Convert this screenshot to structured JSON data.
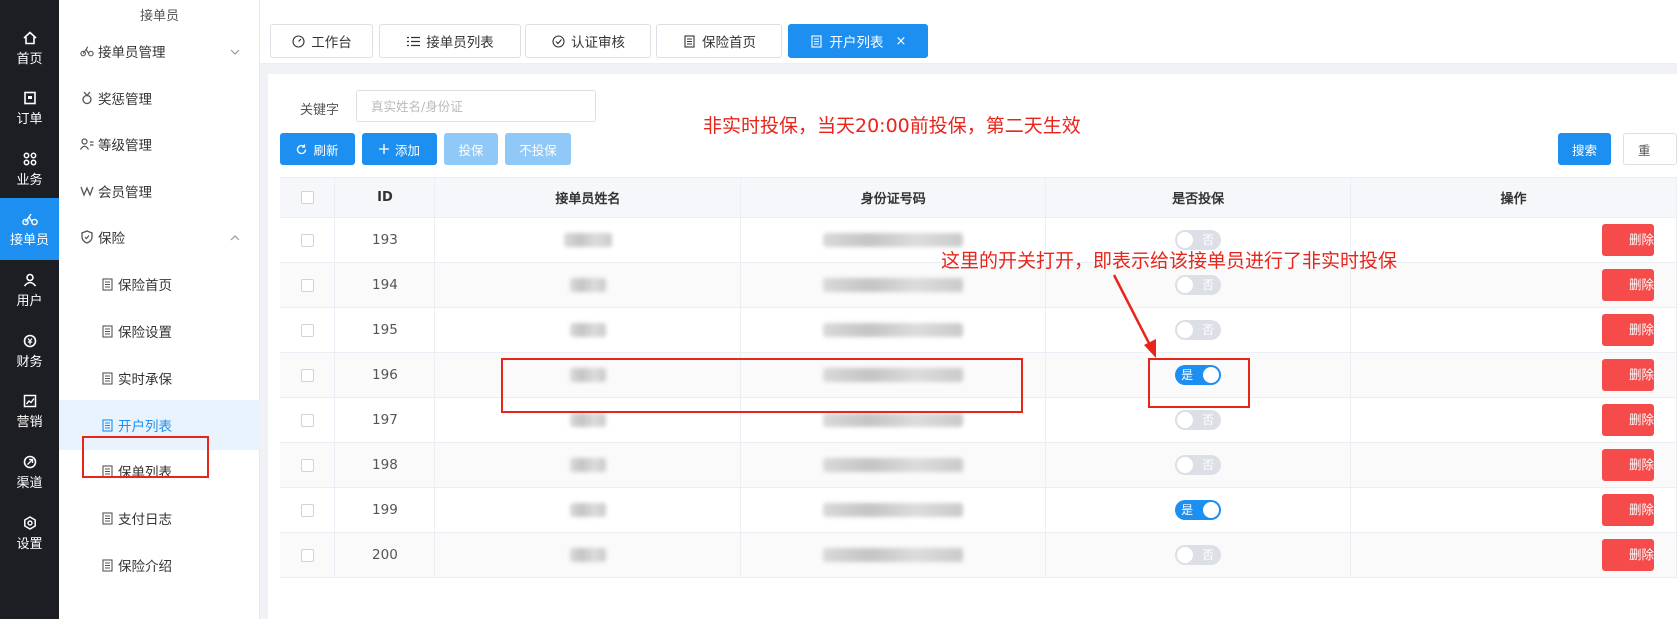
{
  "rail": [
    {
      "label": "首页",
      "icon": "home-icon"
    },
    {
      "label": "订单",
      "icon": "order-icon"
    },
    {
      "label": "业务",
      "icon": "business-icon"
    },
    {
      "label": "接单员",
      "icon": "rider-icon"
    },
    {
      "label": "用户",
      "icon": "user-icon"
    },
    {
      "label": "财务",
      "icon": "finance-icon"
    },
    {
      "label": "营销",
      "icon": "marketing-icon"
    },
    {
      "label": "渠道",
      "icon": "channel-icon"
    },
    {
      "label": "设置",
      "icon": "settings-icon"
    }
  ],
  "sidebar": {
    "title": "接单员",
    "items": [
      {
        "label": "接单员管理",
        "icon": "bike-icon"
      },
      {
        "label": "奖惩管理",
        "icon": "medal-icon"
      },
      {
        "label": "等级管理",
        "icon": "level-icon"
      },
      {
        "label": "会员管理",
        "icon": "vip-icon"
      },
      {
        "label": "保险",
        "icon": "shield-icon"
      },
      {
        "label": "保险首页",
        "icon": "doc-icon"
      },
      {
        "label": "保险设置",
        "icon": "doc-icon"
      },
      {
        "label": "实时承保",
        "icon": "doc-icon"
      },
      {
        "label": "开户列表",
        "icon": "doc-icon"
      },
      {
        "label": "保单列表",
        "icon": "doc-icon"
      },
      {
        "label": "支付日志",
        "icon": "doc-icon"
      },
      {
        "label": "保险介绍",
        "icon": "doc-icon"
      }
    ]
  },
  "tabs": [
    {
      "label": "工作台",
      "icon": "dashboard-icon"
    },
    {
      "label": "接单员列表",
      "icon": "list-icon"
    },
    {
      "label": "认证审核",
      "icon": "check-circle-icon"
    },
    {
      "label": "保险首页",
      "icon": "doc-icon"
    },
    {
      "label": "开户列表",
      "icon": "doc-icon",
      "close": "×"
    }
  ],
  "search": {
    "label": "关键字",
    "placeholder": "真实姓名/身份证"
  },
  "toolbar": {
    "refresh": "刷新",
    "add": "添加",
    "insure": "投保",
    "no_insure": "不投保",
    "search": "搜索",
    "reset": "重"
  },
  "annotations": {
    "notice": "非实时投保，当天20:00前投保，第二天生效",
    "switch_note": "这里的开关打开，即表示给该接单员进行了非实时投保"
  },
  "table": {
    "headers": [
      "ID",
      "接单员姓名",
      "身份证号码",
      "是否投保",
      "操作"
    ],
    "rows": [
      {
        "id": "193",
        "insured": false,
        "switch_label": "否"
      },
      {
        "id": "194",
        "insured": false,
        "switch_label": "否"
      },
      {
        "id": "195",
        "insured": false,
        "switch_label": "否"
      },
      {
        "id": "196",
        "insured": true,
        "switch_label": "是"
      },
      {
        "id": "197",
        "insured": false,
        "switch_label": "否"
      },
      {
        "id": "198",
        "insured": false,
        "switch_label": "否"
      },
      {
        "id": "199",
        "insured": true,
        "switch_label": "是"
      },
      {
        "id": "200",
        "insured": false,
        "switch_label": "否"
      }
    ],
    "delete_label": "删除"
  },
  "colors": {
    "primary": "#1d8ff0",
    "danger": "#f54b4b",
    "annotation": "#e8251b",
    "rail": "#1d1e23"
  }
}
